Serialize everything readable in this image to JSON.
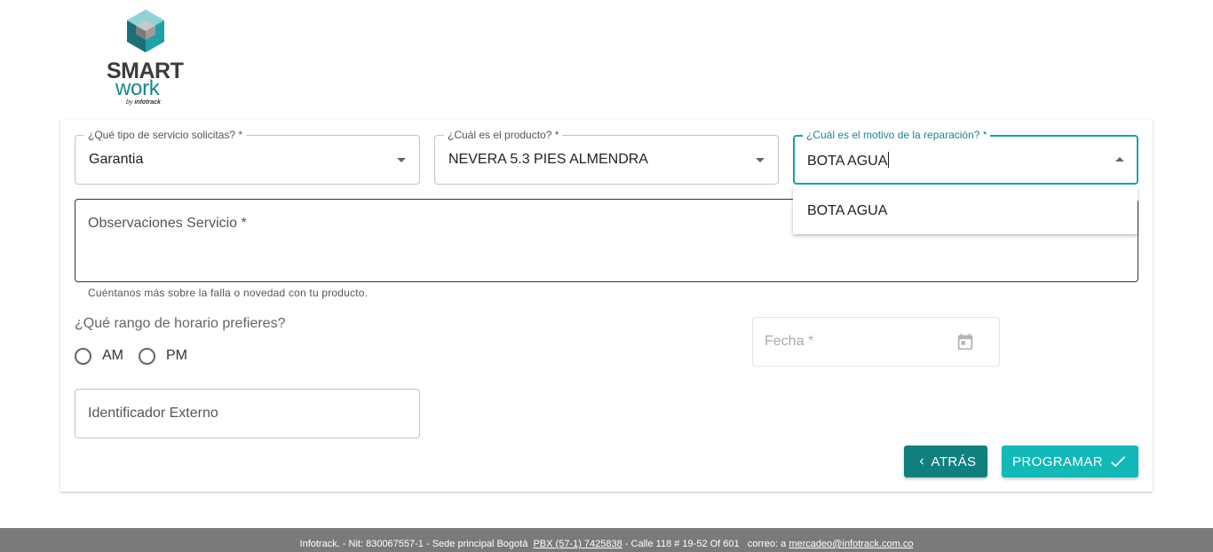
{
  "logo": {
    "line1": "SMART",
    "line2": "work",
    "by": "by",
    "brand": "infotrack"
  },
  "form": {
    "service_type": {
      "label": "¿Qué tipo de servicio solicitas? *",
      "value": "Garantia"
    },
    "product": {
      "label": "¿Cuál es el producto? *",
      "value": "NEVERA 5.3 PIES ALMENDRA"
    },
    "reason": {
      "label": "¿Cuál es el motivo de la reparación? *",
      "value": "BOTA AGUA",
      "options": [
        "BOTA AGUA"
      ]
    },
    "observations": {
      "placeholder": "Observaciones Servicio *",
      "helper": "Cuéntanos más sobre la falla o novedad con tu producto."
    },
    "schedule": {
      "question": "¿Qué rango de horario prefieres?",
      "options": [
        "AM",
        "PM"
      ]
    },
    "date": {
      "placeholder": "Fecha *",
      "icon": "calendar-icon"
    },
    "external_id": {
      "placeholder": "Identificador Externo"
    },
    "buttons": {
      "back": "ATRÁS",
      "schedule": "PROGRAMAR"
    }
  },
  "footer": {
    "prefix": "Infotrack. - Nit: 830067557-1 - Sede principal Bogotá",
    "phone": "PBX (57-1) 7425838",
    "address": "- Calle 118 # 19-52 Of 601",
    "mail_prefix": "correo: a",
    "email": "mercadeo@infotrack.com.co"
  },
  "colors": {
    "teal_dark": "#10807f",
    "teal_bright": "#13b8b8",
    "focus": "#16a3a7",
    "footer_bg": "#7a7a7a"
  }
}
